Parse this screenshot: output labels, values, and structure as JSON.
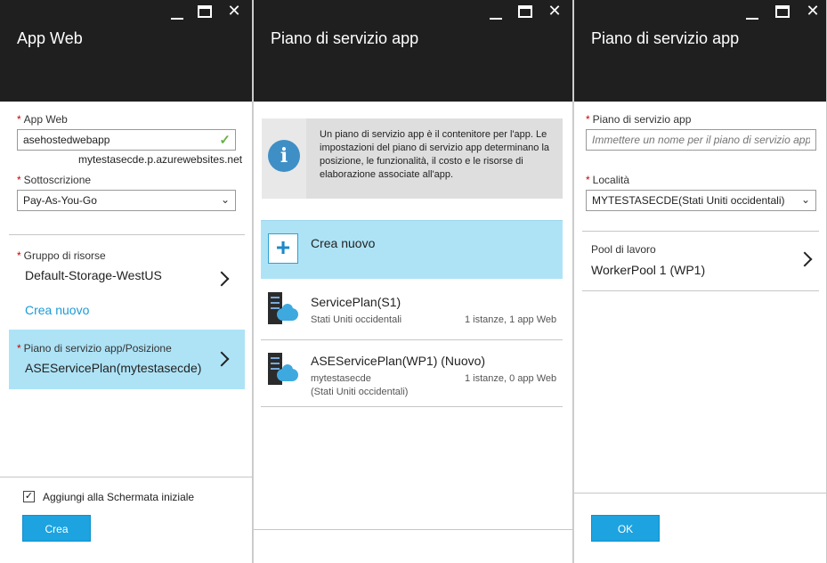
{
  "blade1": {
    "title": "App Web",
    "app_label": "App Web",
    "app_value": "asehostedwebapp",
    "domain": "mytestasecde.p.azurewebsites.net",
    "sub_label": "Sottoscrizione",
    "sub_value": "Pay-As-You-Go",
    "rg_label": "Gruppo di risorse",
    "rg_value": "Default-Storage-WestUS",
    "create_new": "Crea nuovo",
    "plan_label": "Piano di servizio app/Posizione",
    "plan_value": "ASEServicePlan(mytestasecde)",
    "pin_label": "Aggiungi alla Schermata iniziale",
    "create_btn": "Crea"
  },
  "blade2": {
    "title": "Piano di servizio app",
    "info_text": "Un piano di servizio app è il contenitore per l'app. Le impostazioni del piano di servizio app determinano la posizione, le funzionalità, il costo e le risorse di elaborazione associate all'app.",
    "create_new": "Crea nuovo",
    "plans": [
      {
        "name": "ServicePlan(S1)",
        "sub1": "Stati Uniti occidentali",
        "sub2": "",
        "info": "1 istanze, 1 app Web"
      },
      {
        "name": "ASEServicePlan(WP1) (Nuovo)",
        "sub1": "mytestasecde",
        "sub2": "(Stati Uniti occidentali)",
        "info": "1 istanze, 0 app Web"
      }
    ]
  },
  "blade3": {
    "title": "Piano di servizio app",
    "name_label": "Piano di servizio app",
    "name_placeholder": "Immettere un nome per il piano di servizio app",
    "loc_label": "Località",
    "loc_value": "MYTESTASECDE(Stati Uniti occidentali)",
    "pool_label": "Pool di lavoro",
    "pool_value": "WorkerPool 1 (WP1)",
    "ok_btn": "OK"
  },
  "icons": {
    "minimize": "_",
    "maximize": "□",
    "close": "✕",
    "check": "✓",
    "chevron": "❯",
    "info": "i",
    "plus": "+"
  },
  "colors": {
    "accent": "#1ca3e0",
    "selected": "#aee3f6",
    "header": "#1f1f1f",
    "required": "#cc0000"
  }
}
